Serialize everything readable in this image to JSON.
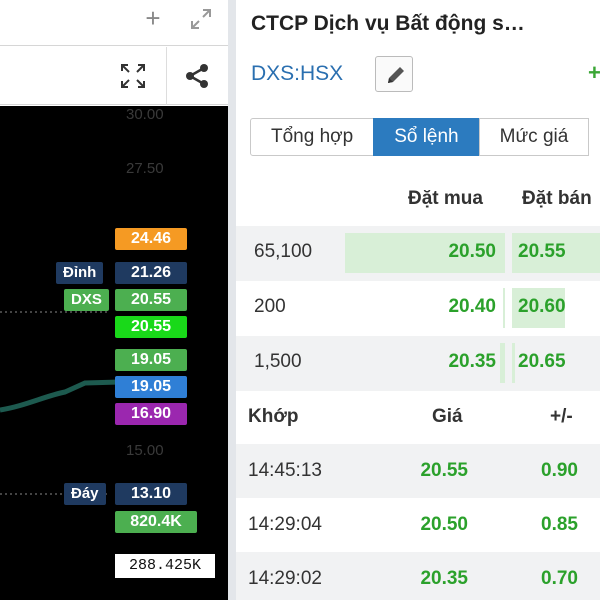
{
  "left_panel": {
    "window_controls": {
      "add": "+",
      "expand": "⤢"
    },
    "price_axis_ticks": [
      "30.00",
      "27.50",
      "15.00"
    ],
    "price_labels_left": [
      {
        "key": "dinh",
        "text": "Đỉnh",
        "color": "#1f3a60"
      },
      {
        "key": "dxs",
        "text": "DXS",
        "color": "#4caf50"
      },
      {
        "key": "day",
        "text": "Đáy",
        "color": "#1f3a60"
      }
    ],
    "price_labels_right": [
      {
        "key": "p1",
        "text": "24.46",
        "color": "#f59a23"
      },
      {
        "key": "p2",
        "text": "21.26",
        "color": "#1f3a60"
      },
      {
        "key": "p3",
        "text": "20.55",
        "color": "#4caf50"
      },
      {
        "key": "p4",
        "text": "20.55",
        "color": "#19d919"
      },
      {
        "key": "p5",
        "text": "19.05",
        "color": "#4caf50"
      },
      {
        "key": "p6",
        "text": "19.05",
        "color": "#2f7fd6"
      },
      {
        "key": "p7",
        "text": "16.90",
        "color": "#9b27af"
      },
      {
        "key": "p8",
        "text": "13.10",
        "color": "#1f3a60"
      },
      {
        "key": "p9",
        "text": "820.4K",
        "color": "#4caf50"
      }
    ],
    "volume_total": "288.425K",
    "line_color": "#1d5a4f"
  },
  "right_panel": {
    "company_title": "CTCP Dịch vụ Bất động s…",
    "ticker": "DXS:HSX",
    "tabs": [
      "Tổng hợp",
      "Sổ lệnh",
      "Mức giá"
    ],
    "active_tab": "Sổ lệnh",
    "order_book": {
      "header_buy": "Đặt mua",
      "header_sell": "Đặt bán",
      "rows": [
        {
          "volume": "65,100",
          "buy": "20.50",
          "sell": "20.55",
          "buy_fill": 1.0,
          "sell_fill": 1.0
        },
        {
          "volume": "200",
          "buy": "20.40",
          "sell": "20.60",
          "buy_fill": 0.01,
          "sell_fill": 0.6
        },
        {
          "volume": "1,500",
          "buy": "20.35",
          "sell": "20.65",
          "buy_fill": 0.03,
          "sell_fill": 0.03
        }
      ]
    },
    "trades": {
      "header_time": "Khớp",
      "header_price": "Giá",
      "header_change": "+/-",
      "rows": [
        {
          "time": "14:45:13",
          "price": "20.55",
          "change": "0.90"
        },
        {
          "time": "14:29:04",
          "price": "20.50",
          "change": "0.85"
        },
        {
          "time": "14:29:02",
          "price": "20.35",
          "change": "0.70"
        }
      ]
    },
    "colors": {
      "up": "#2ba12b",
      "accent": "#2c7bbf",
      "bar": "#d8efd7"
    }
  }
}
